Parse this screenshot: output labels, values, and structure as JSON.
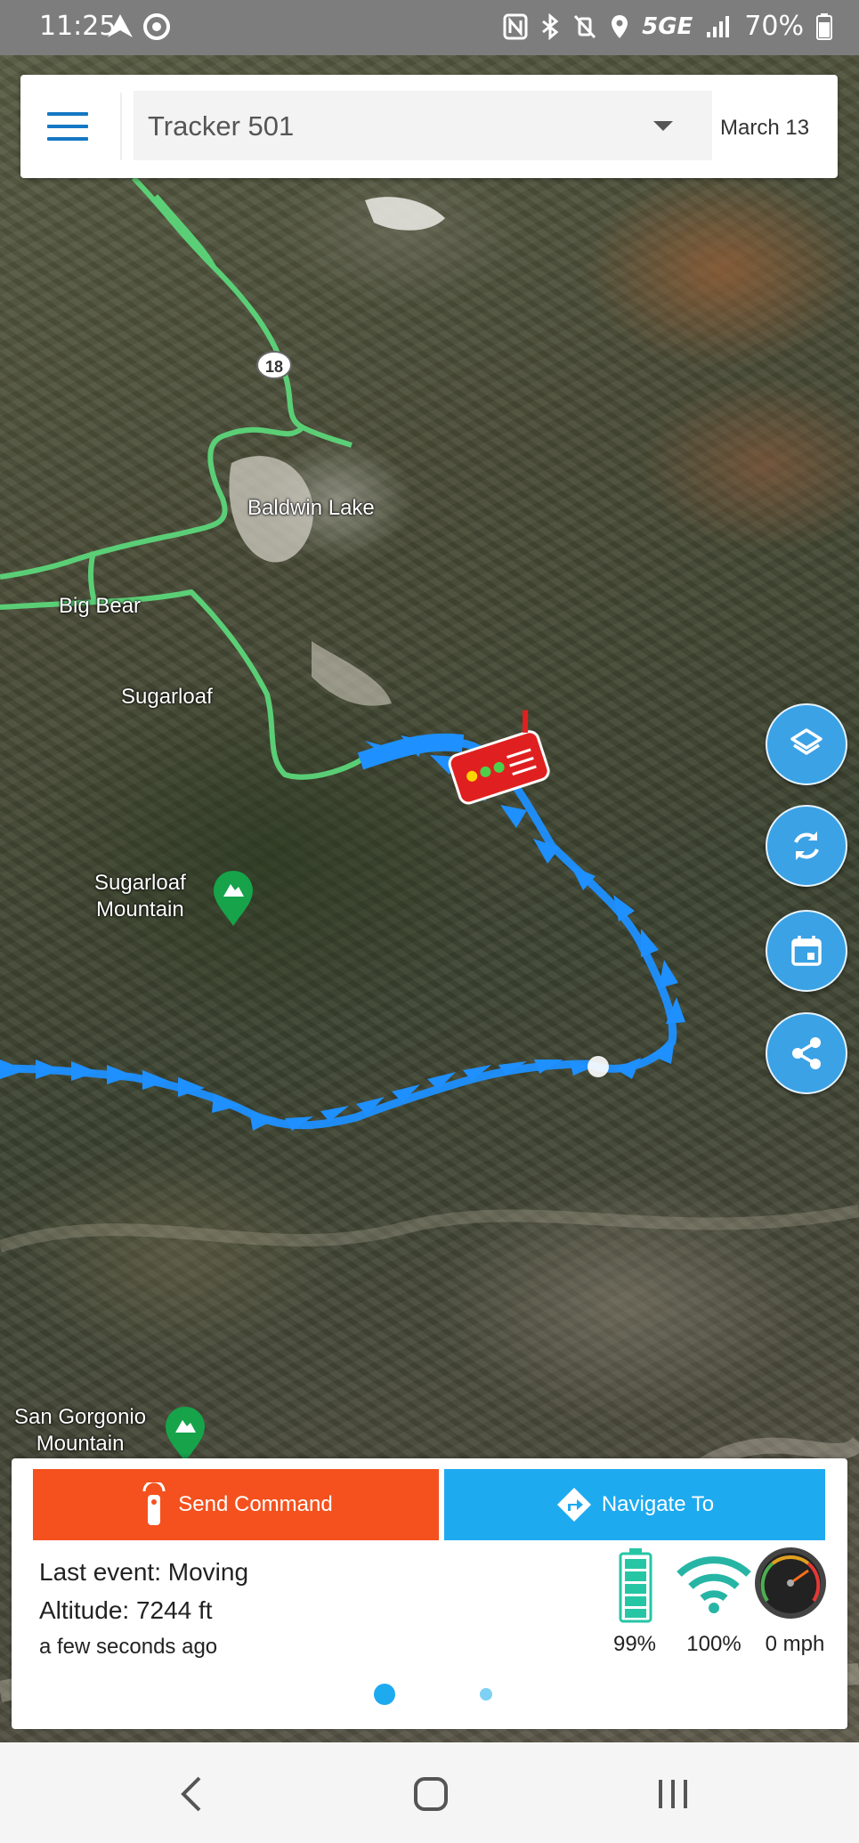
{
  "status_bar": {
    "time": "11:25",
    "battery": "70%",
    "network": "5GE"
  },
  "header": {
    "device": "Tracker 501",
    "date": "March 13"
  },
  "map": {
    "road_shield": "18",
    "labels": [
      "Baldwin Lake",
      "Big Bear",
      "Sugarloaf",
      "Sugarloaf\nMountain",
      "San Gorgonio\nMountain"
    ]
  },
  "fab_buttons": [
    "layers-icon",
    "refresh-icon",
    "calendar-icon",
    "share-icon"
  ],
  "actions": {
    "send_command": "Send Command",
    "navigate_to": "Navigate To"
  },
  "info": {
    "last_event": "Last event: Moving",
    "altitude": "Altitude: 7244 ft",
    "updated": "a few seconds ago"
  },
  "stats": {
    "battery": "99%",
    "signal": "100%",
    "speed": "0 mph"
  },
  "pager": {
    "pages": 2,
    "active": 0
  },
  "colors": {
    "route": "#1e90ff",
    "road": "#4cc86a",
    "send": "#f4511e",
    "navigate": "#1eaaef",
    "fab": "#3ba2e6"
  }
}
